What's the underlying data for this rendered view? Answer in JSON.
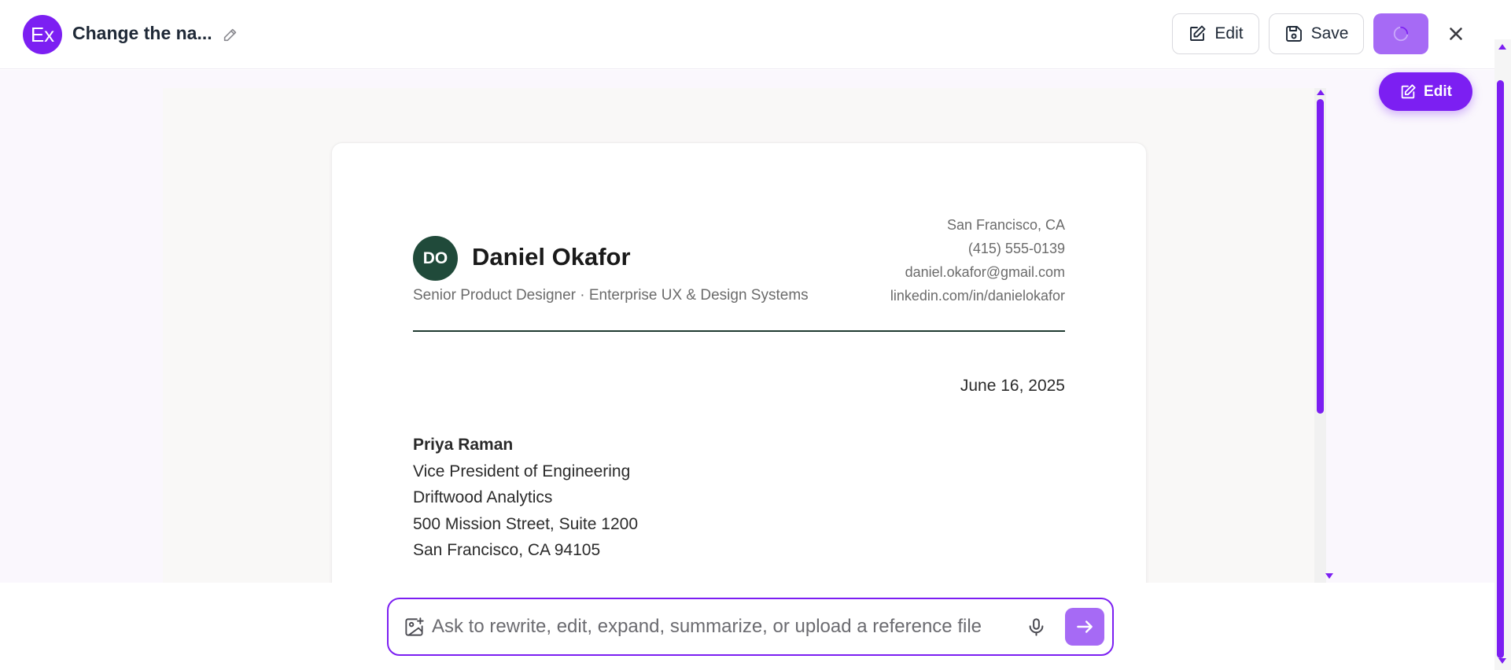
{
  "app": {
    "avatar_text": "Ex",
    "document_title": "Change the na..."
  },
  "toolbar": {
    "edit_label": "Edit",
    "save_label": "Save",
    "floating_edit_label": "Edit"
  },
  "letter": {
    "monogram": "DO",
    "sender_name": "Daniel Okafor",
    "sender_role": "Senior Product Designer · Enterprise UX & Design Systems",
    "contact": [
      "San Francisco, CA",
      "(415) 555-0139",
      "daniel.okafor@gmail.com",
      "linkedin.com/in/danielokafor"
    ],
    "date": "June 16, 2025",
    "recipient": [
      "Priya Raman",
      "Vice President of Engineering",
      "Driftwood Analytics",
      "500 Mission Street, Suite 1200",
      "San Francisco, CA 94105"
    ]
  },
  "prompt": {
    "placeholder": "Ask to rewrite, edit, expand, summarize, or upload a reference file"
  },
  "colors": {
    "accent": "#7c1ff2",
    "accent_light": "#a66af5",
    "monogram_bg": "#204a3a"
  },
  "icons": {
    "title_edit": "pencil-icon",
    "edit": "square-pencil-icon",
    "save": "floppy-disk-icon",
    "loading": "spinner-icon",
    "close": "close-icon",
    "image_upload": "image-plus-icon",
    "mic": "microphone-icon",
    "send": "arrow-right-icon"
  }
}
